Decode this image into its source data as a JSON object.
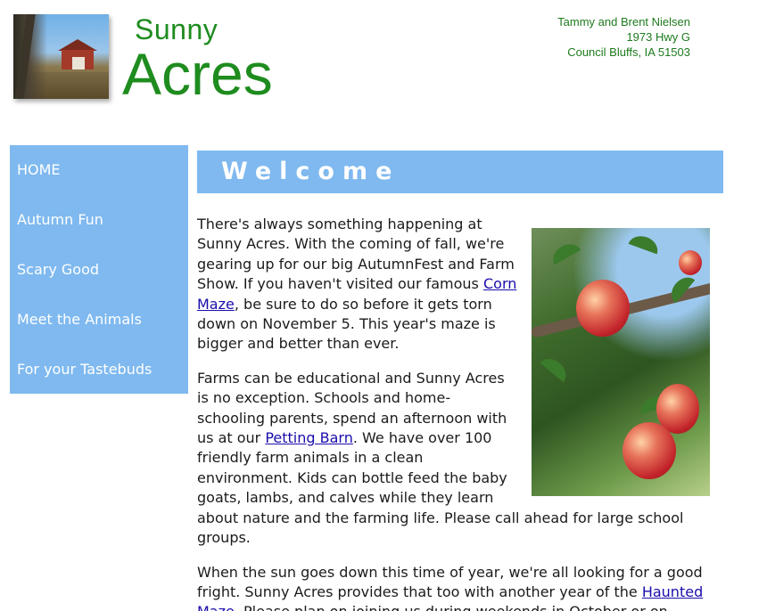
{
  "header": {
    "logo_top": "Sunny",
    "logo_bottom": "Acres",
    "address": {
      "names": "Tammy and Brent Nielsen",
      "street": "1973 Hwy G",
      "city": "Council Bluffs, IA  51503"
    }
  },
  "sidebar": {
    "items": [
      {
        "label": "HOME"
      },
      {
        "label": "Autumn Fun"
      },
      {
        "label": "Scary Good"
      },
      {
        "label": "Meet the Animals"
      },
      {
        "label": "For your Tastebuds"
      }
    ]
  },
  "main": {
    "heading": "Welcome",
    "p1": {
      "before": "There's always something happening at Sunny Acres. With the coming of fall, we're gearing up for our big AutumnFest and Farm Show. If you haven't visited our famous ",
      "link": "Corn Maze",
      "after": ", be sure to do so before it gets torn down on November 5. This year's maze is bigger and better than ever."
    },
    "p2": {
      "before": "Farms can be educational and Sunny Acres is no exception. Schools and home-schooling parents, spend an afternoon with us at our ",
      "link": "Petting Barn",
      "after": ". We have over 100 friendly farm animals in a clean environment. Kids can bottle feed the baby goats, lambs, and calves while they learn about nature and the farming life. Please call ahead for large school groups."
    },
    "p3": {
      "before": "When the sun goes down this time of year, we're all looking for a good fright. Sunny Acres provides that too with another year of the ",
      "link": "Haunted Maze",
      "after": ". Please plan on joining us during weekends in October or on"
    }
  }
}
